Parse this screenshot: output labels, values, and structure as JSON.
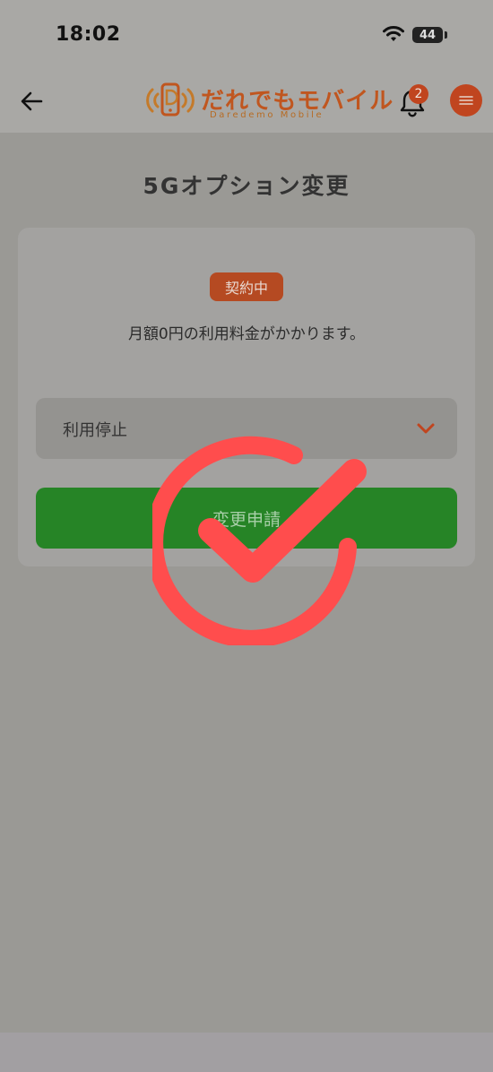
{
  "status_bar": {
    "time": "18:02",
    "battery": "44"
  },
  "header": {
    "logo_text": "だれでもモバイル",
    "logo_sub": "Daredemo Mobile",
    "notification_count": "2"
  },
  "page": {
    "title": "5Gオプション変更"
  },
  "card": {
    "status_badge": "契約中",
    "fee_text": "月額0円の利用料金がかかります。",
    "select_value": "利用停止",
    "submit_label": "変更申請"
  },
  "colors": {
    "brand": "#c0451f",
    "submit": "#268426",
    "check_overlay": "#ff4d4d"
  },
  "icons": {
    "back": "arrow-left-icon",
    "bell": "bell-icon",
    "menu": "hamburger-icon",
    "chevron": "chevron-down-icon",
    "wifi": "wifi-icon",
    "check": "check-circle-icon"
  }
}
